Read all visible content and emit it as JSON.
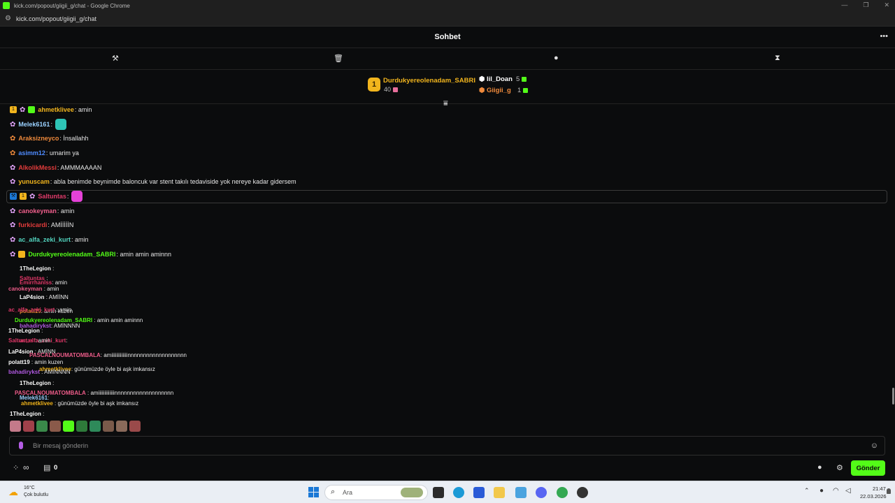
{
  "browser": {
    "window_title": "kick.com/popout/giigii_g/chat - Google Chrome",
    "url": "kick.com/popout/giigii_g/chat"
  },
  "header": {
    "title": "Sohbet"
  },
  "leaderboard": {
    "top": {
      "rank": "1",
      "name": "Durdukyereolenadam_SABRI",
      "count": "40"
    },
    "second": {
      "name": "lil_Doan",
      "count": "5"
    },
    "third": {
      "name": "Giigii_g",
      "count": "1"
    }
  },
  "messages": [
    {
      "user": "ahmetklivee",
      "text": ": amin",
      "color": "#f2b51d"
    },
    {
      "user": "Melek6161",
      "text": ":",
      "color": "#9ad1ff"
    },
    {
      "user": "Araksizneyco",
      "text": ": İnsallahh",
      "color": "#ef8a3c"
    },
    {
      "user": "asimm12",
      "text": ": umarim ya",
      "color": "#4f8cff"
    },
    {
      "user": "AlkolikMessi",
      "text": ": AMMMAAAAN",
      "color": "#e23b3b"
    },
    {
      "user": "yunuscam",
      "text": ": abla benimde beynimde baloncuk var stent takılı tedaviside yok nereye kadar gidersem",
      "color": "#f2b51d"
    },
    {
      "user": "Saltuntas",
      "text": ":",
      "color": "#e23b6b"
    },
    {
      "user": "canokeyman",
      "text": ": amin",
      "color": "#ef5f8c"
    },
    {
      "user": "furkicardi",
      "text": ": AMİİİİİN",
      "color": "#e23b3b"
    },
    {
      "user": "ac_alfa_zeki_kurt",
      "text": ": amin",
      "color": "#53d6c0"
    },
    {
      "user": "Durdukyereolenadam_SABRI",
      "text": ": amin amin aminnn",
      "color": "#53fc18"
    }
  ],
  "overlay_messages": [
    {
      "user": "1TheLegion",
      "text": " :"
    },
    {
      "user": "Saltuntas",
      "text": " :"
    },
    {
      "user": "Emirrhanlss",
      "text": ": amin"
    },
    {
      "user": "canokeyman",
      "text": " : amin"
    },
    {
      "user": "LaP4sion",
      "text": " : AMİİNN"
    },
    {
      "user": "polatt19",
      "text": ": amin kuzen"
    },
    {
      "user": "ac_alfa_zeki_kurt",
      "text": " : amin"
    },
    {
      "user": "Durdukyereolenadam_SABRI",
      "text": " : amin amin aminnn"
    },
    {
      "user": "bahadirykst",
      "text": ": AMİNNNN"
    },
    {
      "user": "1TheLegion",
      "text": " :"
    },
    {
      "user": "ac_alfa_zeki_kurt",
      "text": ":"
    },
    {
      "user": "Saltuntas",
      "text": " : amin"
    },
    {
      "user": "LaP4sion",
      "text": " : AMİNN"
    },
    {
      "user": "PASCALNOUMATOMBALA",
      "text": ": amiiiiiiiiiiiiinnnnnnnnnnnnnnnnnnn"
    },
    {
      "user": "polatt19",
      "text": " : amin kuzen"
    },
    {
      "user": "ahmetklivee",
      "text": ": günümüzde öyle bi aşk imkansız"
    },
    {
      "user": "bahadirykst",
      "text": " : AMİNNNN"
    },
    {
      "user": "1TheLegion",
      "text": " :"
    },
    {
      "user": "PASCALNOUMATOMBALA",
      "text": " : amiiiiiiiiiiiiinnnnnnnnnnnnnnnnnnn"
    },
    {
      "user": "Melek6161",
      "text": ":"
    },
    {
      "user": "ahmetklivee",
      "text": " : günümüzde öyle bi aşk imkansız"
    },
    {
      "user": "1TheLegion",
      "text": " :"
    }
  ],
  "composer": {
    "placeholder": "Bir mesaj gönderin",
    "send_label": "Gönder"
  },
  "footer": {
    "points": "0"
  },
  "taskbar": {
    "temperature": "16°C",
    "condition": "Çok bulutlu",
    "search": "Ara",
    "time": "21:47",
    "date": "22.03.2026"
  },
  "colors": {
    "accent": "#53fc18",
    "background": "#0b0c0d",
    "gold": "#f2b51d"
  }
}
